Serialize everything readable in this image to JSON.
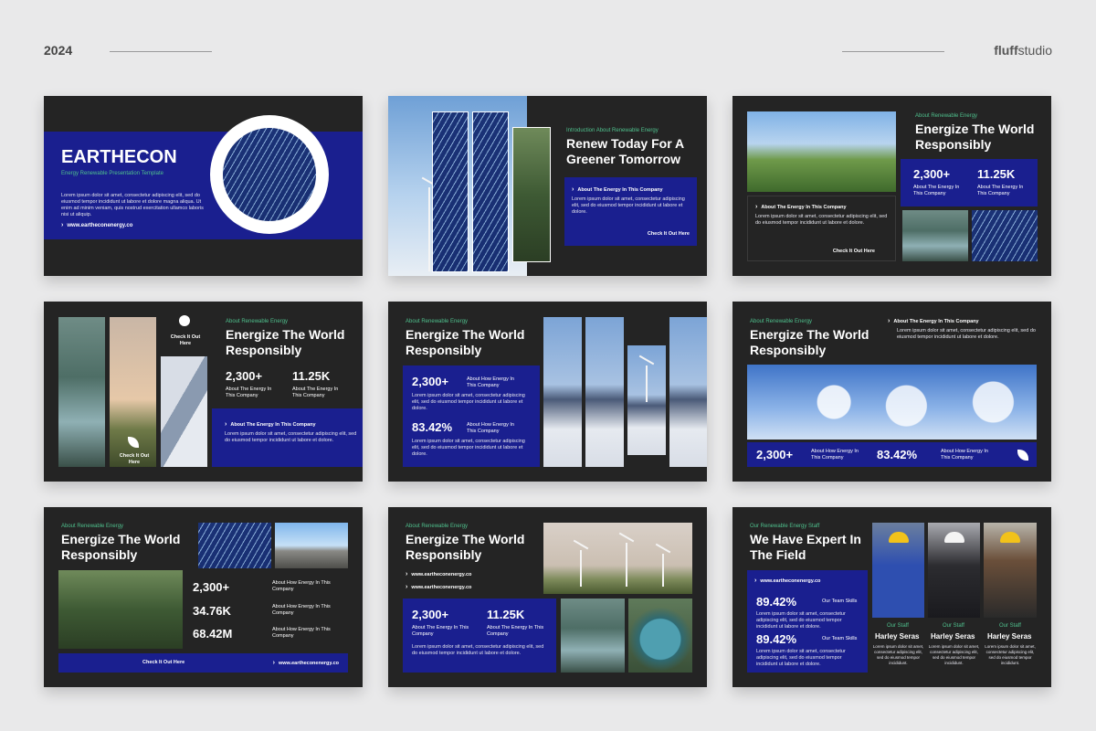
{
  "header": {
    "year": "2024",
    "brand_bold": "fluff",
    "brand_thin": "studio"
  },
  "common": {
    "lorem3": "Lorem ipsum dolor sit amet, consectetur adipiscing elit, sed do eiusmod tempor incididunt ut labore et dolore magna aliqua. Ut enim ad minim veniam, quis nostrud exercitation ullamco.",
    "lorem_long": "Lorem ipsum dolor sit amet, consectetur adipiscing elit, sed do eiusmod tempor incididunt ut labore et dolore magna aliqua. Ut enim ad minim veniam, quis nostrud exercitation ullamco laboris nisi ut aliquip ex ea commodo consequat. Duis aute irure dolor in reprehenderit in voluptate velit esse cillum dolore.",
    "lorem_short": "Lorem ipsum dolor sit amet, consectetur adipiscing elit, sed do eiusmod tempor incididunt ut labore et dolore.",
    "energize": "Energize The World Responsibly",
    "about_renewable": "About Renewable Energy",
    "about_energy_company": "About The Energy In This Company",
    "about_how_energy": "About How Energy In This Company",
    "check_it_out": "Check It Out Here",
    "website": "www.eartheconenergy.co"
  },
  "slide1": {
    "title": "EARTHECON",
    "subtitle": "Energy Renewable Presentation Template",
    "body": "Lorem ipsum dolor sit amet, consectetur adipiscing elit, sed do eiusmod tempor incididunt ut labore et dolore magna aliqua. Ut enim ad minim veniam, quis nostrud exercitation ullamco laboris nisi ut aliquip.",
    "website": "www.eartheconenergy.co"
  },
  "slide2": {
    "eyebrow": "Introduction About Renewable Energy",
    "title": "Renew Today For A Greener Tomorrow",
    "box_heading": "About The Energy In This Company",
    "link": "Check It Out Here"
  },
  "slide3": {
    "stat1": "2,300+",
    "stat2": "11.25K",
    "link": "Check It Out Here"
  },
  "slide4": {
    "stat1": "2,300+",
    "stat2": "11.25K",
    "check_top": "Check It Out Here",
    "check_bottom": "Check It Out Here"
  },
  "slide5": {
    "stat1": "2,300+",
    "stat2": "83.42%"
  },
  "slide6": {
    "stat1": "2,300+",
    "stat2": "83.42%"
  },
  "slide7": {
    "stat1": "2,300+",
    "stat2": "34.76K",
    "stat3": "68.42M"
  },
  "slide8": {
    "stat1": "2,300+",
    "stat2": "11.25K"
  },
  "slide9": {
    "eyebrow": "Our Renewable Energy Staff",
    "title": "We Have Expert In The Field",
    "website": "www.eartheconenergy.co",
    "stat": "89.42%",
    "stat_label": "Our Team Skills",
    "staff_role": "Our Staff",
    "staff_name": "Harley Seras",
    "staff_desc": "Lorem ipsum dolor sit amet, consectetur adipiscing elit, sed do eiusmod tempor incididunt."
  },
  "colors": {
    "accent": "#1a1f8f",
    "dark": "#242424",
    "green": "#4fc08d"
  }
}
